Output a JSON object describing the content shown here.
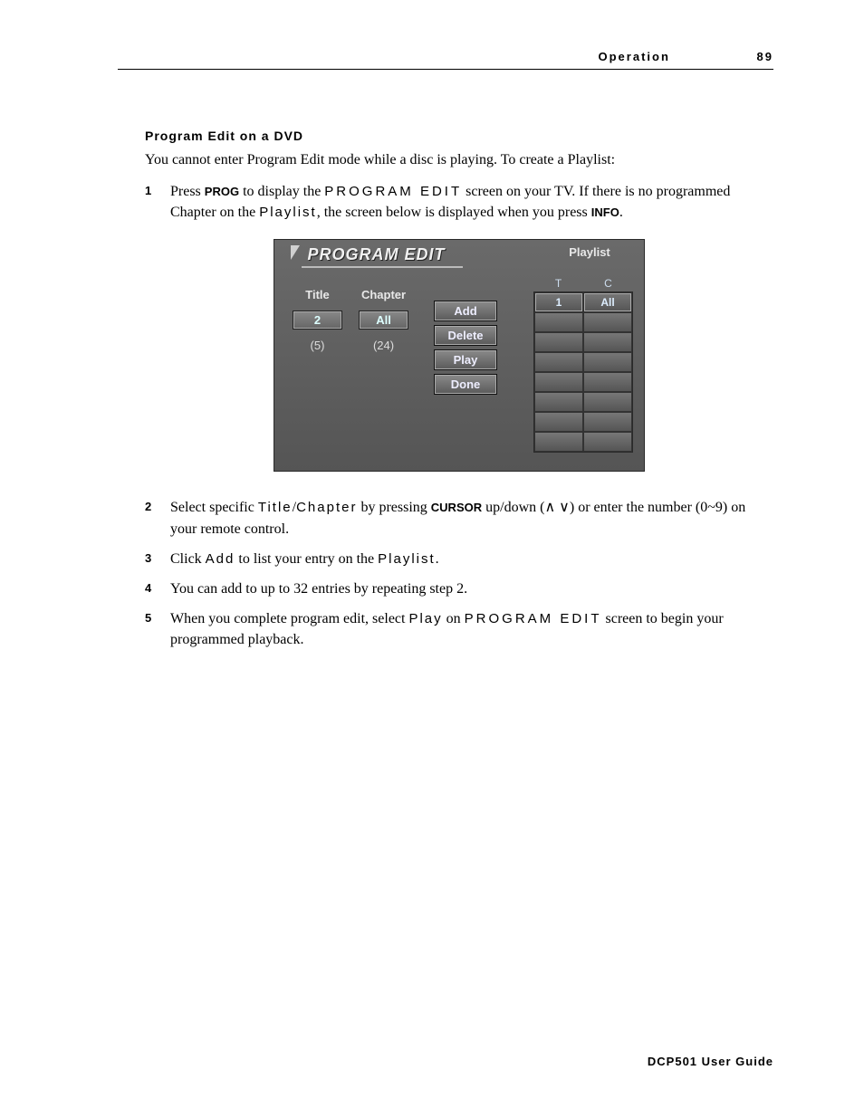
{
  "header": {
    "section": "Operation",
    "page": "89"
  },
  "section_title": "Program Edit on a DVD",
  "intro": "You cannot enter Program Edit mode while a disc is playing. To create a Playlist:",
  "steps": {
    "s1": {
      "num": "1",
      "t1": "Press ",
      "k1": "PROG",
      "t2": " to display the ",
      "osd1": "PROGRAM EDIT",
      "t3": " screen on your TV. If there is no programmed Chapter on the ",
      "osd2": "Playlist",
      "t4": ", the screen below is displayed when you press ",
      "k2": "INFO",
      "t5": "."
    },
    "s2": {
      "num": "2",
      "t1": "Select specific ",
      "osd1": "Title",
      "slash": "/",
      "osd2": "Chapter",
      "t2": " by pressing ",
      "k1": "CURSOR",
      "t3": " up/down (∧ ∨) or enter the number (0~9) on your remote control."
    },
    "s3": {
      "num": "3",
      "t1": "Click ",
      "osd1": "Add",
      "t2": " to list your entry on the ",
      "osd2": "Playlist",
      "t3": "."
    },
    "s4": {
      "num": "4",
      "t1": "You can add to up to 32 entries by repeating step 2."
    },
    "s5": {
      "num": "5",
      "t1": "When you complete program edit, select ",
      "osd1": "Play",
      "t2": " on ",
      "osd2": "PROGRAM EDIT",
      "t3": " screen to begin your programmed playback."
    }
  },
  "screenshot": {
    "title": "PROGRAM EDIT",
    "playlist_label": "Playlist",
    "cols": {
      "title": "Title",
      "chapter": "Chapter"
    },
    "title_val": "2",
    "chapter_val": "All",
    "title_count": "(5)",
    "chapter_count": "(24)",
    "buttons": {
      "add": "Add",
      "delete": "Delete",
      "play": "Play",
      "done": "Done"
    },
    "pl_head": {
      "t": "T",
      "c": "C"
    },
    "pl_row1": {
      "t": "1",
      "c": "All"
    }
  },
  "footer": "DCP501 User Guide"
}
